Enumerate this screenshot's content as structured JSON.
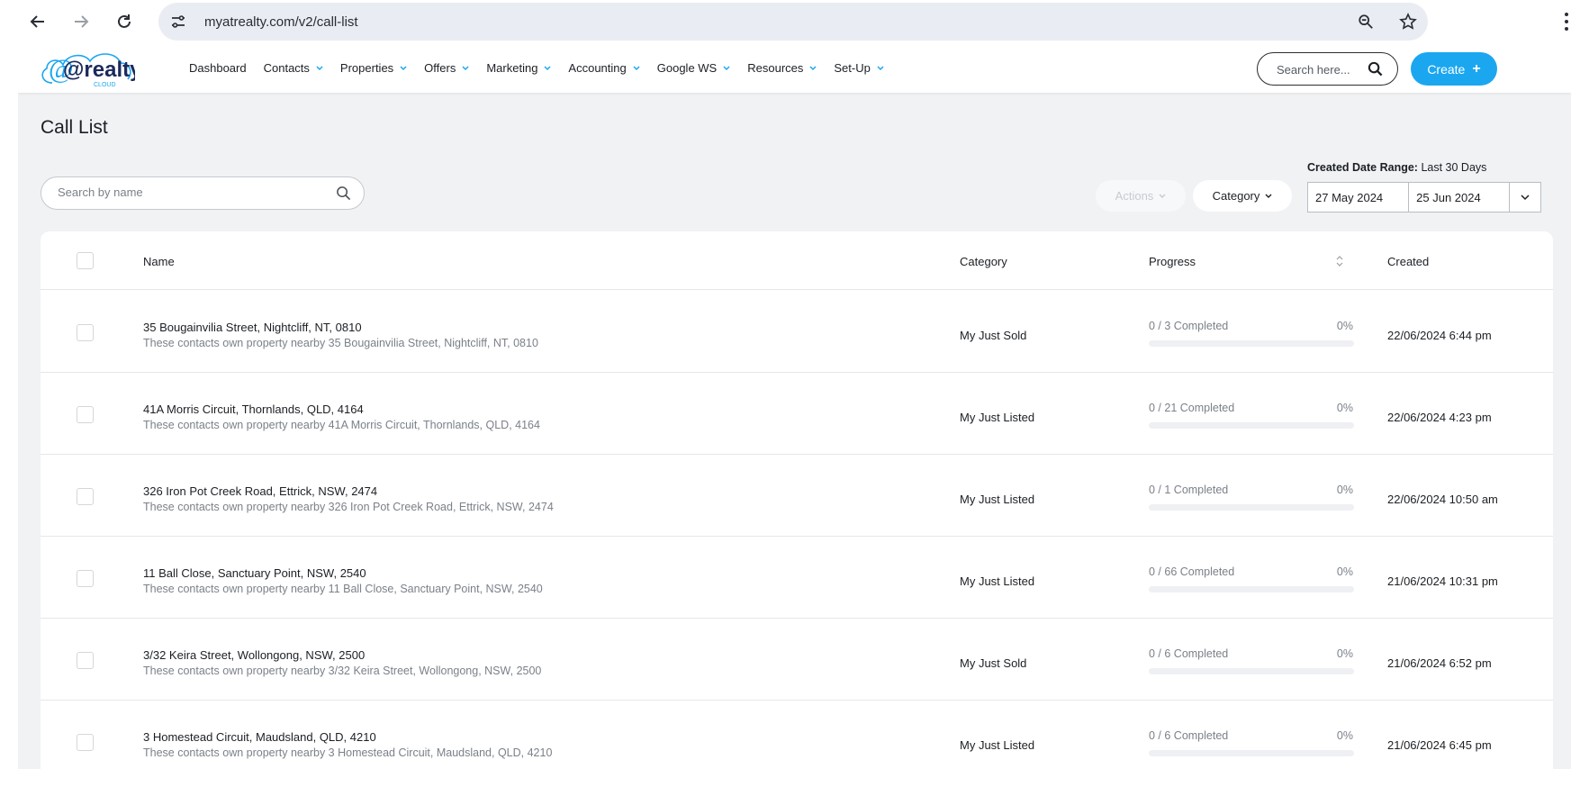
{
  "browser": {
    "url": "myatrealty.com/v2/call-list"
  },
  "header": {
    "logo_text": "@realty",
    "logo_subtext": "CLOUD",
    "menu": [
      {
        "label": "Dashboard",
        "has_dropdown": false
      },
      {
        "label": "Contacts",
        "has_dropdown": true
      },
      {
        "label": "Properties",
        "has_dropdown": true
      },
      {
        "label": "Offers",
        "has_dropdown": true
      },
      {
        "label": "Marketing",
        "has_dropdown": true
      },
      {
        "label": "Accounting",
        "has_dropdown": true
      },
      {
        "label": "Google WS",
        "has_dropdown": true
      },
      {
        "label": "Resources",
        "has_dropdown": true
      },
      {
        "label": "Set-Up",
        "has_dropdown": true
      }
    ],
    "search_placeholder": "Search here...",
    "create_label": "Create",
    "create_icon": "+"
  },
  "page": {
    "title": "Call List",
    "search_placeholder": "Search by name",
    "actions_label": "Actions",
    "category_label": "Category",
    "date_range_label": "Created Date Range:",
    "date_range_value": "Last 30 Days",
    "date_from": "27 May 2024",
    "date_to": "25 Jun 2024"
  },
  "table": {
    "columns": {
      "name": "Name",
      "category": "Category",
      "progress": "Progress",
      "created": "Created"
    },
    "rows": [
      {
        "name": "35 Bougainvilia Street, Nightcliff, NT, 0810",
        "description": "These contacts own property nearby 35 Bougainvilia Street, Nightcliff, NT, 0810",
        "category": "My Just Sold",
        "progress_text": "0 / 3 Completed",
        "progress_pct": "0%",
        "progress_value": 0,
        "created": "22/06/2024 6:44 pm"
      },
      {
        "name": "41A Morris Circuit, Thornlands, QLD, 4164",
        "description": "These contacts own property nearby 41A Morris Circuit, Thornlands, QLD, 4164",
        "category": "My Just Listed",
        "progress_text": "0 / 21 Completed",
        "progress_pct": "0%",
        "progress_value": 0,
        "created": "22/06/2024 4:23 pm"
      },
      {
        "name": "326 Iron Pot Creek Road, Ettrick, NSW, 2474",
        "description": "These contacts own property nearby 326 Iron Pot Creek Road, Ettrick, NSW, 2474",
        "category": "My Just Listed",
        "progress_text": "0 / 1 Completed",
        "progress_pct": "0%",
        "progress_value": 0,
        "created": "22/06/2024 10:50 am"
      },
      {
        "name": "11 Ball Close, Sanctuary Point, NSW, 2540",
        "description": "These contacts own property nearby 11 Ball Close, Sanctuary Point, NSW, 2540",
        "category": "My Just Listed",
        "progress_text": "0 / 66 Completed",
        "progress_pct": "0%",
        "progress_value": 0,
        "created": "21/06/2024 10:31 pm"
      },
      {
        "name": "3/32 Keira Street, Wollongong, NSW, 2500",
        "description": "These contacts own property nearby 3/32 Keira Street, Wollongong, NSW, 2500",
        "category": "My Just Sold",
        "progress_text": "0 / 6 Completed",
        "progress_pct": "0%",
        "progress_value": 0,
        "created": "21/06/2024 6:52 pm"
      },
      {
        "name": "3 Homestead Circuit, Maudsland, QLD, 4210",
        "description": "These contacts own property nearby 3 Homestead Circuit, Maudsland, QLD, 4210",
        "category": "My Just Listed",
        "progress_text": "0 / 6 Completed",
        "progress_pct": "0%",
        "progress_value": 0,
        "created": "21/06/2024 6:45 pm"
      }
    ]
  },
  "colors": {
    "accent": "#1aa7f0",
    "page_bg": "#f0f2f4"
  }
}
